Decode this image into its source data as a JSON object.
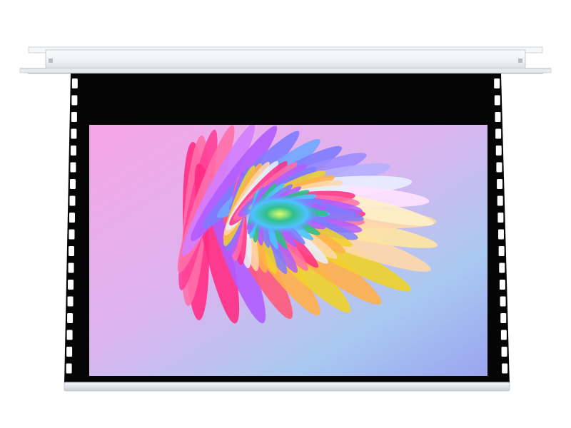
{
  "product": {
    "housing_color": "#f1f3f5",
    "housing_shadow": "#c9ced4",
    "black_border_color": "#050505",
    "bottom_bar_color": "#eef0f2"
  },
  "projected_image": {
    "subject": "flower",
    "background_colors": [
      "#f6a5e6",
      "#dcb4ef",
      "#a9c9f1",
      "#9aa4ef"
    ],
    "petal_colors": [
      "#ff2d84",
      "#ff6fa8",
      "#b05cff",
      "#7d7cff",
      "#f0d22a",
      "#ffb04a",
      "#ffd8a8",
      "#e9f0ff"
    ],
    "center_colors": [
      "#2fbf8b",
      "#4dc3ff",
      "#e3ff6a"
    ]
  }
}
